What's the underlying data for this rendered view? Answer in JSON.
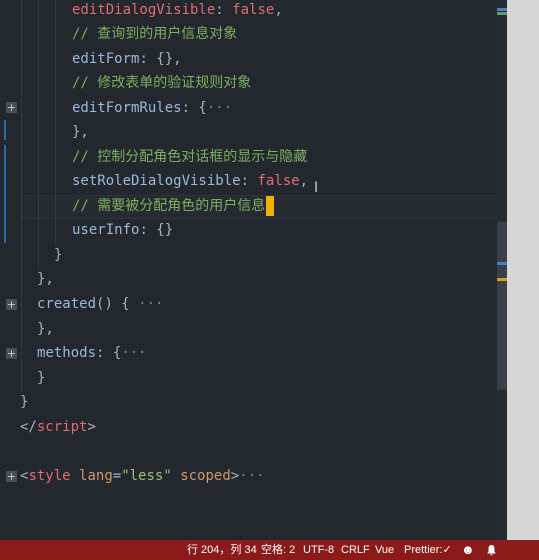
{
  "code": {
    "line1": {
      "prop": "editDialogVisible",
      "punc": ": ",
      "value": "false",
      "end": ","
    },
    "line2": "// 查询到的用户信息对象",
    "line3": {
      "prop": "editForm",
      "rest": ": {},"
    },
    "line4": "// 修改表单的验证规则对象",
    "line5": {
      "prop": "editFormRules",
      "rest": ": {",
      "ellipsis": "···"
    },
    "line6": "},",
    "line7": "// 控制分配角色对话框的显示与隐藏",
    "line8": {
      "prop": "setRoleDialogVisible",
      "punc": ": ",
      "value": "false",
      "end": ","
    },
    "line9": "// 需要被分配角色的用户信息",
    "line10": {
      "prop": "userInfo",
      "rest": ": {}"
    },
    "line11": "}",
    "line12": "},",
    "line13": {
      "prop": "created",
      "rest": "() {",
      "ellipsis": "···"
    },
    "line14": "},",
    "line15": {
      "prop": "methods",
      "rest": ": {",
      "ellipsis": "···"
    },
    "line16": "}",
    "line17": "}",
    "line18": {
      "open": "</",
      "tag": "script",
      "close": ">"
    },
    "line20": {
      "open": "<",
      "tag": "style",
      "attr1": "lang",
      "eq": "=",
      "val": "\"less\"",
      "attr2": "scoped",
      "close": ">",
      "ellipsis": "···"
    }
  },
  "statusbar": {
    "position": "行 204，列 34",
    "spaces": "空格: 2",
    "encoding": "UTF-8",
    "eol": "CRLF",
    "language": "Vue",
    "prettier": "Prettier:",
    "check_icon": "check-icon",
    "smiley_icon": "smiley-icon",
    "bell_icon": "bell-icon"
  },
  "colors": {
    "statusbar_bg": "#8b1a1a",
    "editor_bg": "#23272e",
    "cursor": "#f2b100"
  }
}
